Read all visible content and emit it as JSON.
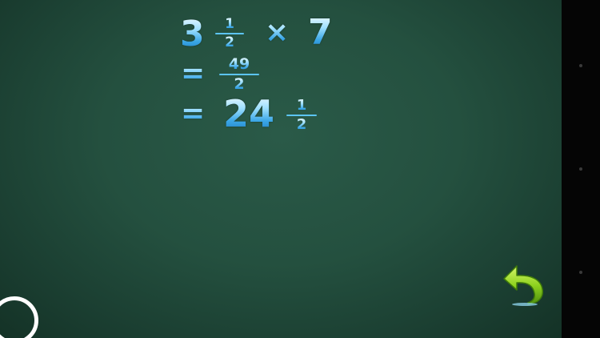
{
  "equation": {
    "line1": {
      "whole": "3",
      "frac_num": "1",
      "frac_den": "2",
      "operator": "×",
      "multiplier": "7"
    },
    "line2": {
      "equals": "=",
      "frac_num": "49",
      "frac_den": "2"
    },
    "line3": {
      "equals": "=",
      "whole": "24",
      "frac_num": "1",
      "frac_den": "2"
    }
  },
  "colors": {
    "board": "#24503f",
    "digits": "#7fd2ff",
    "back_arrow": "#8ed21f"
  },
  "icons": {
    "back": "undo-arrow-icon",
    "corner": "circle-button-icon"
  }
}
